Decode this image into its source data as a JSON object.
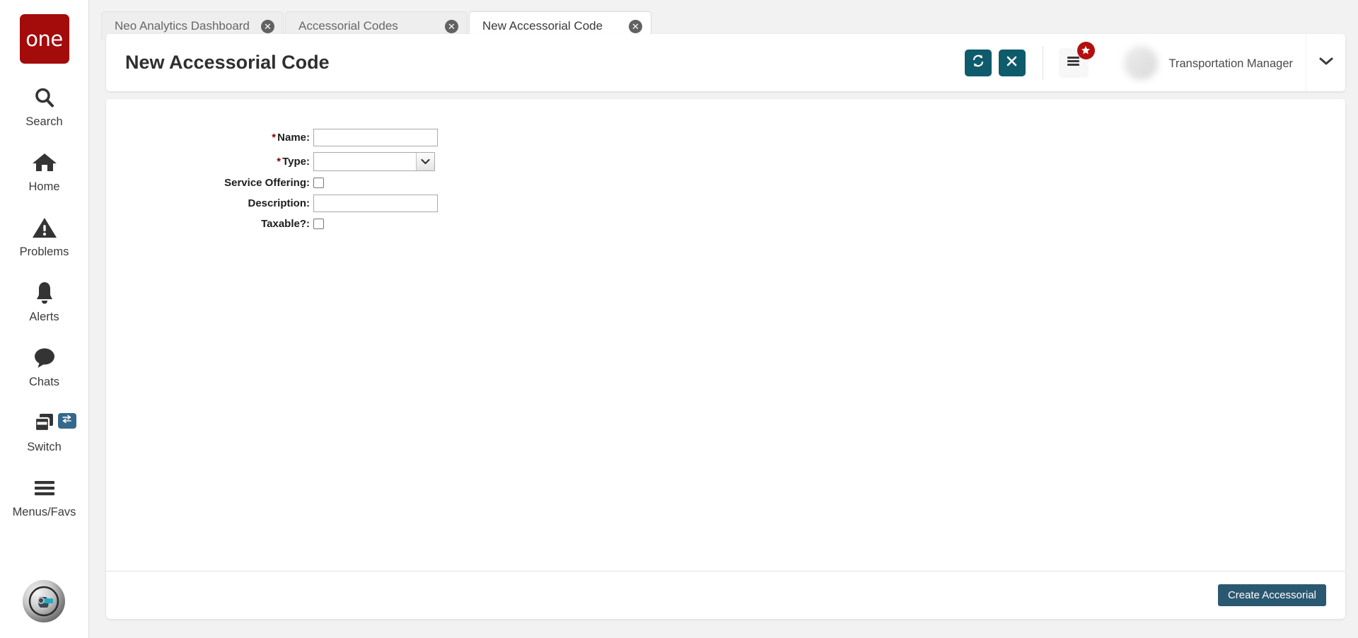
{
  "brand": {
    "logo_text": "one",
    "logo_color": "#a40b0b"
  },
  "sidebar": {
    "items": [
      {
        "label": "Search",
        "icon": "search-icon"
      },
      {
        "label": "Home",
        "icon": "home-icon"
      },
      {
        "label": "Problems",
        "icon": "warning-triangle-icon"
      },
      {
        "label": "Alerts",
        "icon": "bell-icon"
      },
      {
        "label": "Chats",
        "icon": "chat-bubble-icon"
      },
      {
        "label": "Switch",
        "icon": "switch-windows-icon",
        "badge_icon": "swap-arrows-icon"
      },
      {
        "label": "Menus/Favs",
        "icon": "hamburger-icon"
      }
    ],
    "avatar_icon": "profile-avatar-icon"
  },
  "tabs": [
    {
      "label": "Neo Analytics Dashboard",
      "active": false,
      "close_icon": "close-circle-icon"
    },
    {
      "label": "Accessorial Codes",
      "active": false,
      "close_icon": "close-circle-icon"
    },
    {
      "label": "New Accessorial Code",
      "active": true,
      "close_icon": "close-circle-icon"
    }
  ],
  "header": {
    "title": "New Accessorial Code",
    "buttons": [
      {
        "name": "refresh-button",
        "icon": "refresh-icon",
        "color": "#0e5b6b"
      },
      {
        "name": "close-button",
        "icon": "x-icon",
        "color": "#0e5b6b"
      }
    ],
    "menu_button": {
      "icon": "hamburger-icon",
      "badge_icon": "star-icon",
      "badge_color": "#b40e0e"
    },
    "user": {
      "name": "",
      "role": "Transportation Manager",
      "sub": "",
      "caret_icon": "chevron-down-icon"
    }
  },
  "form": {
    "fields": [
      {
        "label": "Name:",
        "required": true,
        "type": "text",
        "value": "",
        "placeholder": ""
      },
      {
        "label": "Type:",
        "required": true,
        "type": "select",
        "value": "",
        "options": []
      },
      {
        "label": "Service Offering:",
        "required": false,
        "type": "checkbox",
        "checked": false
      },
      {
        "label": "Description:",
        "required": false,
        "type": "text",
        "value": "",
        "placeholder": ""
      },
      {
        "label": "Taxable?:",
        "required": false,
        "type": "checkbox",
        "checked": false
      }
    ]
  },
  "footer": {
    "create_label": "Create Accessorial",
    "create_color": "#2b5871"
  }
}
